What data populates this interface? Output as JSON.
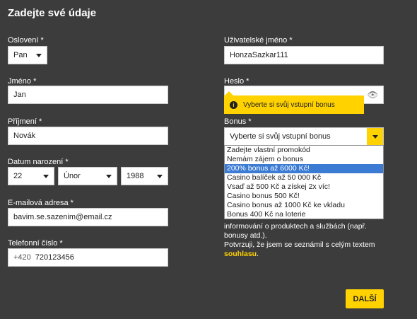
{
  "form": {
    "title": "Zadejte své údaje",
    "salutation": {
      "label": "Oslovení *",
      "value": "Pan"
    },
    "first_name": {
      "label": "Jméno *",
      "value": "Jan"
    },
    "last_name": {
      "label": "Příjmení *",
      "value": "Novák"
    },
    "birthdate": {
      "label": "Datum narození *",
      "day": "22",
      "month": "Únor",
      "year": "1988"
    },
    "email": {
      "label": "E-mailová adresa *",
      "value": "bavim.se.sazenim@email.cz"
    },
    "phone": {
      "label": "Telefonní číslo *",
      "prefix": "+420",
      "value": "720123456"
    },
    "username": {
      "label": "Uživatelské jméno *",
      "value": "HonzaSazkar111"
    },
    "password": {
      "label": "Heslo *",
      "icon": "eye-icon"
    },
    "bonus": {
      "label": "Bonus *",
      "value": "Vyberte si svůj vstupní bonus",
      "tooltip": "Vyberte si svůj vstupní bonus",
      "options": [
        "Zadejte vlastní promokód",
        "Nemám zájem o bonus",
        "200% bonus až 6000 Kč!",
        "Casino balíček až 50 000 Kč",
        "Vsaď až 500 Kč a získej 2x víc!",
        "Casino bonus 500 Kč!",
        "Casino bonus až 1000 Kč ke vkladu",
        "Bonus 400 Kč na loterie"
      ],
      "highlighted_index": 2
    },
    "consent": {
      "line1": "informování o produktech a službách (např.",
      "line2": "bonusy atd.).",
      "line3": "Potvrzuji, že jsem se seznámil s celým textem",
      "link": "souhlasu",
      "after_link": "."
    },
    "next_button": "DALŠÍ"
  },
  "colors": {
    "background": "#3d3c3d",
    "accent": "#ffd200",
    "highlight": "#3b7bd4"
  }
}
